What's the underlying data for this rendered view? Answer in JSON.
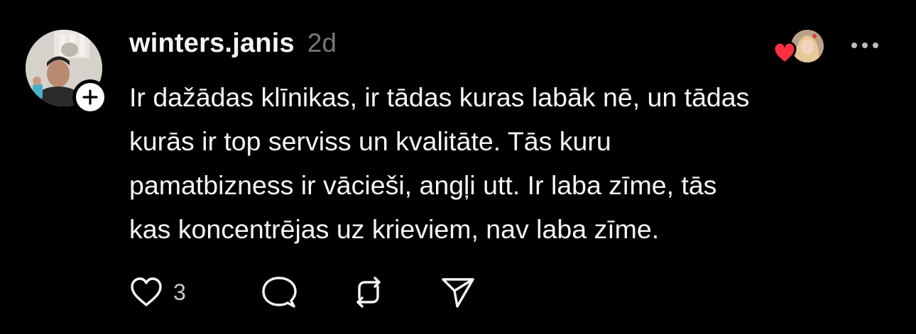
{
  "post": {
    "username": "winters.janis",
    "timestamp": "2d",
    "text_lines": [
      "Ir dažādas klīnikas, ir tādas kuras labāk nē, un tādas",
      "kurās ir top serviss un kvalitāte. Tās kuru",
      "pamatbizness ir vācieši, angļi utt. Ir laba zīme, tās",
      "kas koncentrējas uz krieviem, nav laba zīme."
    ],
    "like_count": "3"
  },
  "icons": {
    "follow": "plus-icon",
    "liked_badge": "heart-icon",
    "more": "more-horizontal-icon",
    "like": "heart-outline-icon",
    "reply": "comment-icon",
    "repost": "repost-icon",
    "share": "send-icon"
  },
  "colors": {
    "background": "#000000",
    "text_primary": "#f3f5f7",
    "text_secondary": "#777777",
    "heart_red": "#ff3040"
  }
}
